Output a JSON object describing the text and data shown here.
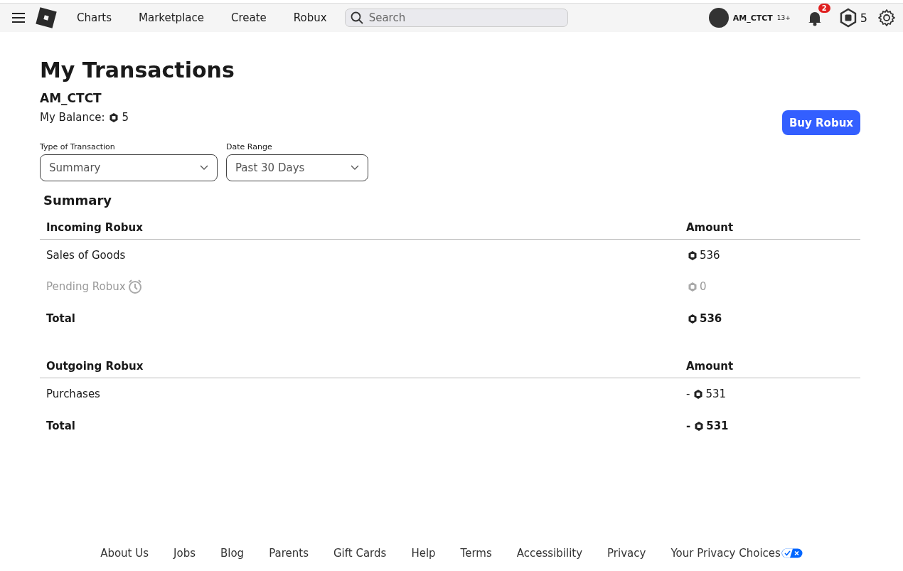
{
  "nav": {
    "links": [
      "Charts",
      "Marketplace",
      "Create",
      "Robux"
    ],
    "search": {
      "placeholder": "Search"
    },
    "user": {
      "name": "AM_CTCT",
      "age": "13+"
    },
    "notifications": "2",
    "robux": "5"
  },
  "page": {
    "title": "My Transactions",
    "username": "AM_CTCT",
    "balance_label": "My Balance:",
    "balance": "5",
    "buy_button": "Buy Robux"
  },
  "filters": [
    {
      "label": "Type of Transaction",
      "value": "Summary"
    },
    {
      "label": "Date Range",
      "value": "Past 30 Days"
    }
  ],
  "summary_title": "Summary",
  "sections": [
    {
      "heading": "Incoming Robux",
      "amount_heading": "Amount",
      "rows": [
        {
          "label": "Sales of Goods",
          "kind": "item",
          "amount": "536"
        },
        {
          "label": "Pending Robux",
          "kind": "pending",
          "amount": "0"
        },
        {
          "label": "Total",
          "kind": "total",
          "amount": "536"
        }
      ]
    },
    {
      "heading": "Outgoing Robux",
      "amount_heading": "Amount",
      "rows": [
        {
          "label": "Purchases",
          "kind": "item",
          "prefix": "-",
          "amount": "531"
        },
        {
          "label": "Total",
          "kind": "total",
          "prefix": "-",
          "amount": "531"
        }
      ]
    }
  ],
  "footer": [
    "About Us",
    "Jobs",
    "Blog",
    "Parents",
    "Gift Cards",
    "Help",
    "Terms",
    "Accessibility",
    "Privacy",
    "Your Privacy Choices"
  ]
}
